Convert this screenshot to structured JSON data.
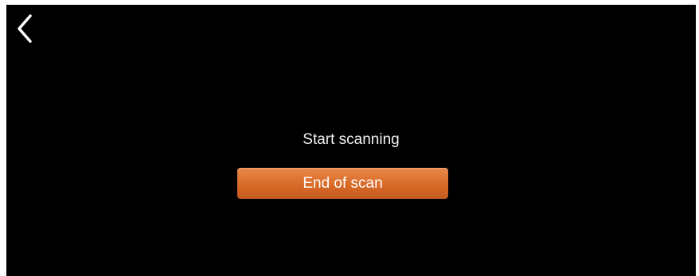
{
  "header": {
    "back_icon": "chevron-left-icon"
  },
  "main": {
    "status_text": "Start scanning",
    "end_scan_label": "End of scan"
  },
  "colors": {
    "background": "#000000",
    "text": "#ffffff",
    "accent": "#e07a38"
  }
}
